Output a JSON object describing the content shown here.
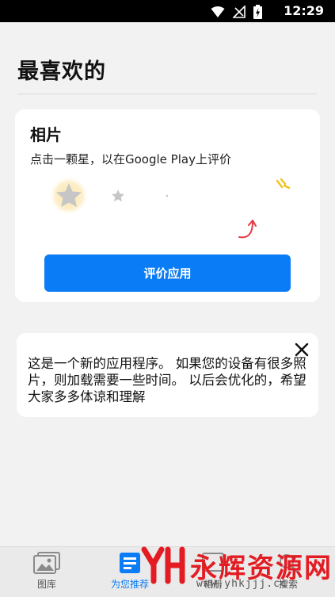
{
  "status_bar": {
    "time": "12:29"
  },
  "header": {
    "title": "最喜欢的"
  },
  "rating_card": {
    "title": "相片",
    "subtitle": "点击一颗星，以在Google Play上评价",
    "button_label": "评价应用"
  },
  "notice_card": {
    "text": "这是一个新的应用程序。 如果您的设备有很多照片，则加载需要一些时间。 以后会优化的，希望大家多多体谅和理解"
  },
  "bottom_nav": {
    "items": [
      {
        "label": "图库",
        "icon": "gallery-icon",
        "active": false
      },
      {
        "label": "为您推荐",
        "icon": "recommend-icon",
        "active": true
      },
      {
        "label": "相册",
        "icon": "album-icon",
        "active": false
      },
      {
        "label": "搜索",
        "icon": "search-icon",
        "active": false
      }
    ]
  },
  "watermark": {
    "title": "永辉资源网",
    "url": "www.yhkjjj.cc"
  },
  "colors": {
    "accent": "#0a7cf5",
    "watermark_red": "#e31c23",
    "star_glow": "#fbe3a6"
  }
}
